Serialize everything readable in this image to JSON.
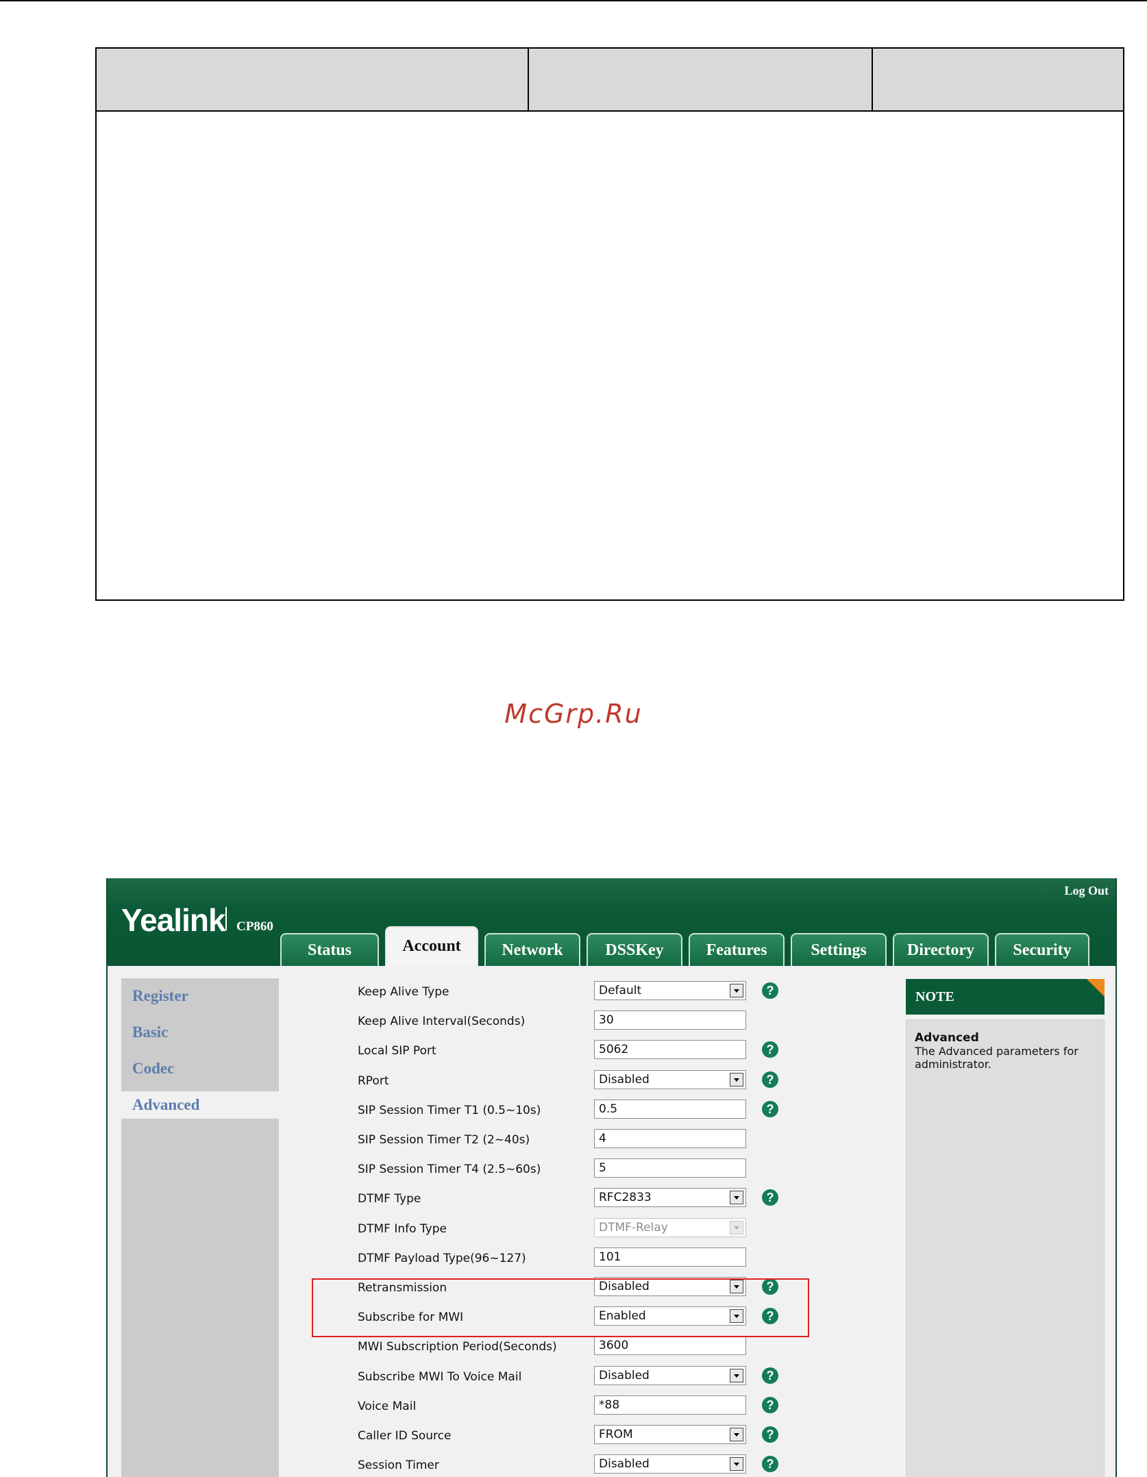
{
  "watermark": "McGrp.Ru",
  "app": {
    "logo": "Yealink",
    "model": "CP860",
    "logout": "Log Out",
    "tabs": [
      "Status",
      "Account",
      "Network",
      "DSSKey",
      "Features",
      "Settings",
      "Directory",
      "Security"
    ],
    "active_tab": "Account",
    "sidebar": [
      "Register",
      "Basic",
      "Codec",
      "Advanced"
    ],
    "active_sidebar": "Advanced",
    "fields": [
      {
        "label": "Keep Alive Type",
        "value": "Default",
        "kind": "select",
        "help": true
      },
      {
        "label": "Keep Alive Interval(Seconds)",
        "value": "30",
        "kind": "text",
        "help": false
      },
      {
        "label": "Local SIP Port",
        "value": "5062",
        "kind": "text",
        "help": true
      },
      {
        "label": "RPort",
        "value": "Disabled",
        "kind": "select",
        "help": true
      },
      {
        "label": "SIP Session Timer T1 (0.5~10s)",
        "value": "0.5",
        "kind": "text",
        "help": true
      },
      {
        "label": "SIP Session Timer T2 (2~40s)",
        "value": "4",
        "kind": "text",
        "help": false
      },
      {
        "label": "SIP Session Timer T4 (2.5~60s)",
        "value": "5",
        "kind": "text",
        "help": false
      },
      {
        "label": "DTMF Type",
        "value": "RFC2833",
        "kind": "select",
        "help": true
      },
      {
        "label": "DTMF Info Type",
        "value": "DTMF-Relay",
        "kind": "select-disabled",
        "help": false
      },
      {
        "label": "DTMF Payload Type(96~127)",
        "value": "101",
        "kind": "text",
        "help": false
      },
      {
        "label": "Retransmission",
        "value": "Disabled",
        "kind": "select",
        "help": true
      },
      {
        "label": "Subscribe for MWI",
        "value": "Enabled",
        "kind": "select",
        "help": true
      },
      {
        "label": "MWI Subscription Period(Seconds)",
        "value": "3600",
        "kind": "text",
        "help": false
      },
      {
        "label": "Subscribe MWI To Voice Mail",
        "value": "Disabled",
        "kind": "select",
        "help": true
      },
      {
        "label": "Voice Mail",
        "value": "*88",
        "kind": "text",
        "help": true
      },
      {
        "label": "Caller ID Source",
        "value": "FROM",
        "kind": "select",
        "help": true
      },
      {
        "label": "Session Timer",
        "value": "Disabled",
        "kind": "select",
        "help": true
      }
    ],
    "note": {
      "header": "NOTE",
      "title": "Advanced",
      "text": "The Advanced parameters for administrator."
    },
    "colors": {
      "brand_green": "#0b5a37",
      "nav_text": "#5c7dad",
      "highlight": "#e02020",
      "help": "#137c58"
    }
  }
}
